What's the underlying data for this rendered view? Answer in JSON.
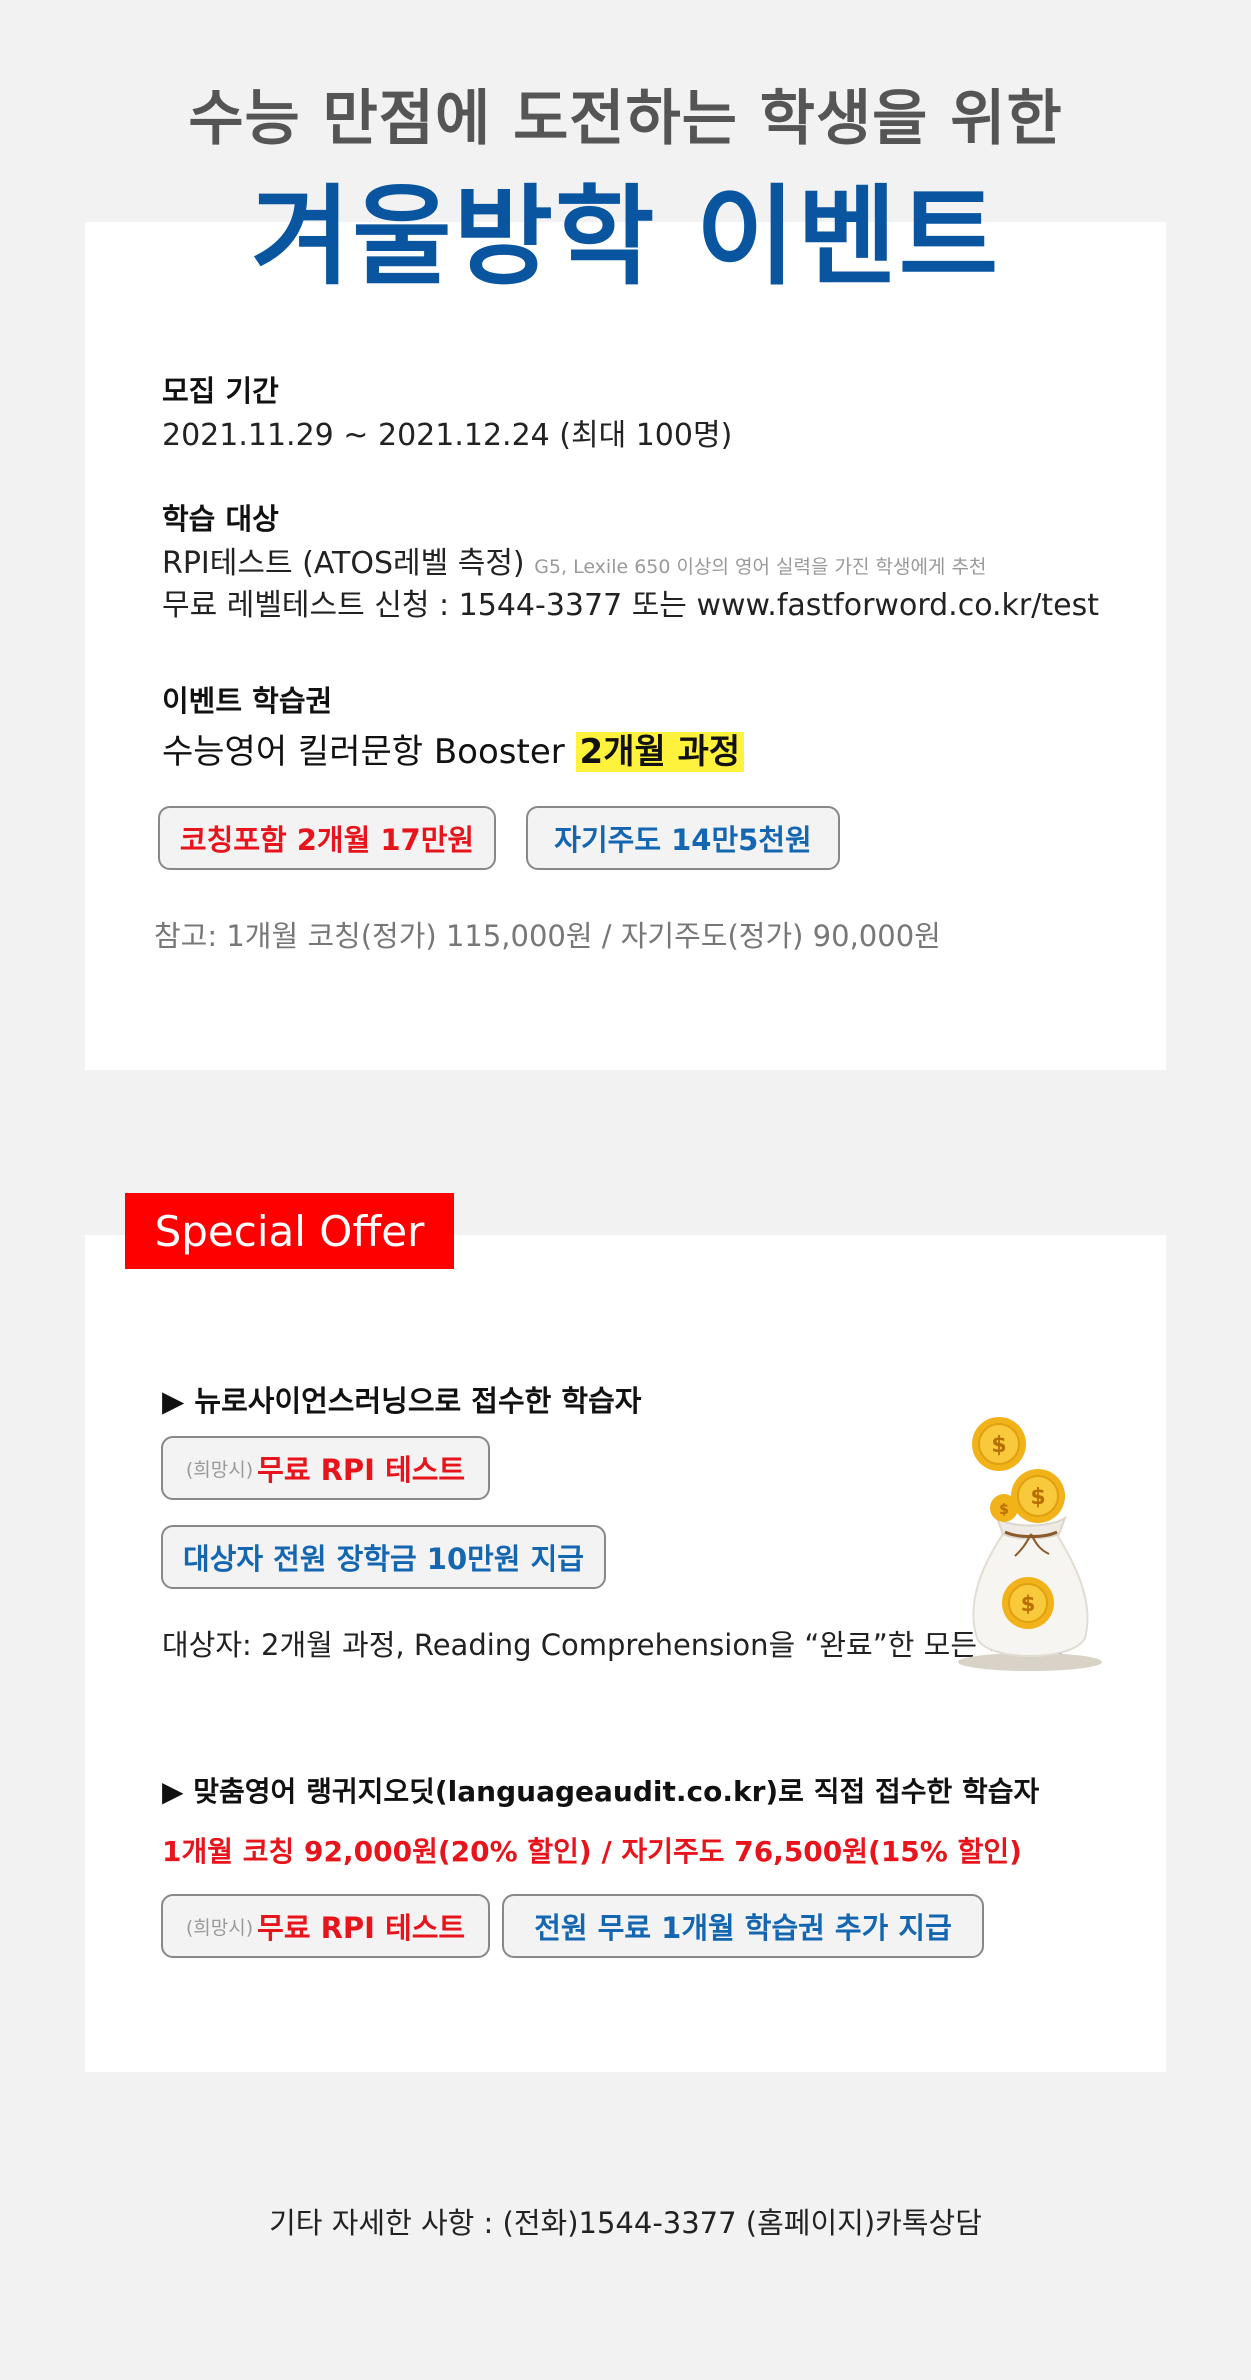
{
  "header": {
    "subtitle": "수능 만점에 도전하는 학생을 위한",
    "title": "겨울방학 이벤트"
  },
  "event": {
    "recruit_label": "모집 기간",
    "recruit_value": "2021.11.29 ~ 2021.12.24 (최대 100명)",
    "target_label": "학습 대상",
    "target_line1": "RPI테스트 (ATOS레벨 측정)",
    "target_line1_note": "G5, Lexile 650 이상의 영어 실력을 가진 학생에게 추천",
    "target_line2": "무료 레벨테스트 신청 : 1544-3377 또는 www.fastforword.co.kr/test",
    "pass_label": "이벤트 학습권",
    "pass_course": "수능영어 킬러문항 Booster",
    "pass_course_highlight": "2개월 과정",
    "btn_coaching": "코칭포함 2개월 17만원",
    "btn_self": "자기주도 14만5천원",
    "note": "참고: 1개월 코칭(정가) 115,000원 / 자기주도(정가) 90,000원"
  },
  "special": {
    "badge": "Special Offer",
    "section1_title": "▶ 뉴로사이언스러닝으로 접수한 학습자",
    "pill_prefix": "(희망시)",
    "pill_free_test": "무료 RPI 테스트",
    "pill_scholarship": "대상자 전원 장학금 10만원 지급",
    "section1_note": "대상자: 2개월 과정, Reading Comprehension을 “완료”한 모든 학습자",
    "section2_title": "▶ 맞춤영어 랭귀지오딧(languageaudit.co.kr)로 직접 접수한 학습자",
    "section2_price": "1개월 코칭 92,000원(20% 할인) / 자기주도 76,500원(15% 할인)",
    "pill2_prefix": "(희망시)",
    "pill2_free_test": "무료 RPI 테스트",
    "pill2_extra": "전원 무료 1개월 학습권 추가 지급"
  },
  "footer": {
    "contact": "기타 자세한 사항 : (전화)1544-3377  (홈페이지)카톡상담"
  },
  "colors": {
    "title_blue": "#0a55a0",
    "accent_red": "#e8141c",
    "accent_blue": "#1466b0",
    "highlight_yellow": "#fff23d",
    "badge_red": "#ff0000"
  },
  "icons": {
    "money_bag": "money-bag-icon"
  }
}
